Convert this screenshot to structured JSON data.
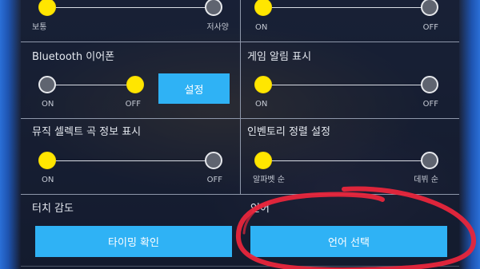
{
  "settings": {
    "top_left": {
      "min_label": "보통",
      "max_label": "저사양",
      "state": "min"
    },
    "top_right": {
      "min_label": "ON",
      "max_label": "OFF",
      "state": "min"
    },
    "bluetooth": {
      "title": "Bluetooth 이어폰",
      "min_label": "ON",
      "max_label": "OFF",
      "state": "max",
      "button_label": "설정"
    },
    "game_alert": {
      "title": "게임 알림 표시",
      "min_label": "ON",
      "max_label": "OFF",
      "state": "min"
    },
    "music_select": {
      "title": "뮤직 셀렉트 곡 정보 표시",
      "min_label": "ON",
      "max_label": "OFF",
      "state": "min"
    },
    "inventory_sort": {
      "title": "인벤토리 정렬 설정",
      "min_label": "알파벳 순",
      "max_label": "데뷔 순",
      "state": "min"
    },
    "touch": {
      "title": "터치 감도",
      "button_label": "타이밍 확인"
    },
    "language": {
      "title": "언어",
      "button_label": "언어 선택"
    }
  },
  "colors": {
    "button": "#2fb2f5",
    "knob_on": "#ffe600",
    "knob_off": "#5f6470",
    "annotation": "#e8263c"
  },
  "annotation": {
    "shape": "hand-drawn circle around language selection"
  }
}
